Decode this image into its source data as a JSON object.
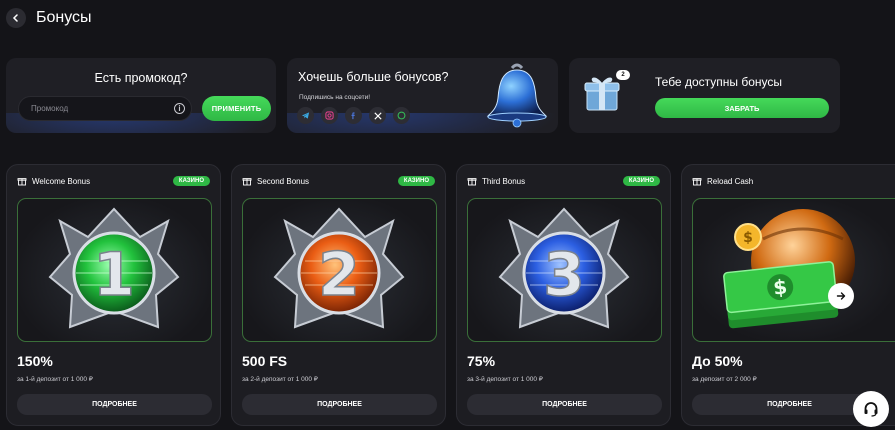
{
  "header": {
    "title": "Бонусы"
  },
  "promo": {
    "title": "Есть промокод?",
    "placeholder": "Промокод",
    "apply_label": "ПРИМЕНИТЬ"
  },
  "social": {
    "title": "Хочешь больше бонусов?",
    "subtitle": "Подпишись на соцсети!",
    "icons": [
      "telegram-icon",
      "instagram-icon",
      "facebook-icon",
      "x-icon",
      "whatsapp-icon"
    ]
  },
  "available": {
    "title": "Тебе доступны бонусы",
    "count": "2",
    "claim_label": "ЗАБРАТЬ"
  },
  "cards": [
    {
      "name": "Welcome Bonus",
      "badge": "КАЗИНО",
      "value": "150%",
      "desc": "за 1-й депозит от 1 000 ₽",
      "more": "ПОДРОБНЕЕ",
      "medal_number": "1",
      "color": "#2fd44a"
    },
    {
      "name": "Second Bonus",
      "badge": "КАЗИНО",
      "value": "500 FS",
      "desc": "за 2-й депозит от 1 000 ₽",
      "more": "ПОДРОБНЕЕ",
      "medal_number": "2",
      "color": "#f06a1e"
    },
    {
      "name": "Third Bonus",
      "badge": "КАЗИНО",
      "value": "75%",
      "desc": "за 3-й депозит от 1 000 ₽",
      "more": "ПОДРОБНЕЕ",
      "medal_number": "3",
      "color": "#2f62e8"
    },
    {
      "name": "Reload Cash",
      "badge": "",
      "value": "До 50%",
      "desc": "за депозит от 2 000 ₽",
      "more": "ПОДРОБНЕЕ",
      "medal_number": "",
      "color": "#3fbf3a"
    }
  ],
  "colors": {
    "accent_green": "#2fb845",
    "background": "#141418",
    "panel": "#1f1f25"
  }
}
